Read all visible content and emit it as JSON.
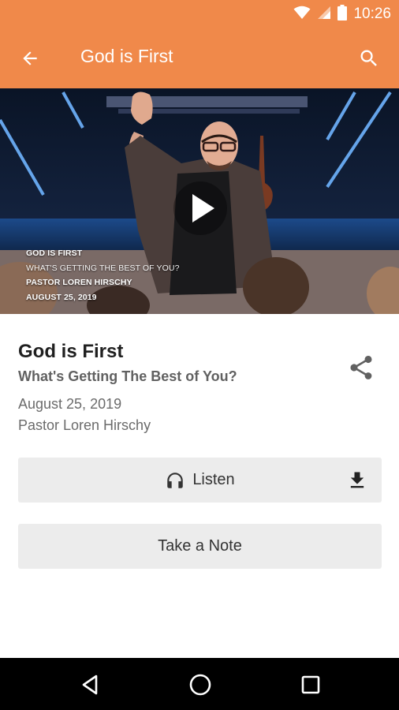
{
  "status_bar": {
    "time": "10:26",
    "icons": [
      "wifi-icon",
      "signal-icon",
      "battery-icon"
    ]
  },
  "app_bar": {
    "title": "God is First",
    "back_icon": "arrow-back-icon",
    "search_icon": "search-icon",
    "color": "#f0894a"
  },
  "video": {
    "overlay": {
      "line1": "GOD IS FIRST",
      "line2": "WHAT'S GETTING THE BEST OF YOU?",
      "line3": "PASTOR LOREN HIRSCHY",
      "line4": "AUGUST 25, 2019"
    },
    "play_icon": "play-icon"
  },
  "sermon": {
    "title": "God is First",
    "subtitle": "What's Getting The Best of You?",
    "date": "August 25, 2019",
    "speaker": "Pastor Loren Hirschy",
    "share_icon": "share-icon"
  },
  "actions": {
    "listen_label": "Listen",
    "listen_icon": "headphones-icon",
    "download_icon": "download-icon",
    "note_label": "Take a Note"
  },
  "nav_bar": {
    "items": [
      "back-triangle-icon",
      "home-circle-icon",
      "recents-square-icon"
    ]
  }
}
